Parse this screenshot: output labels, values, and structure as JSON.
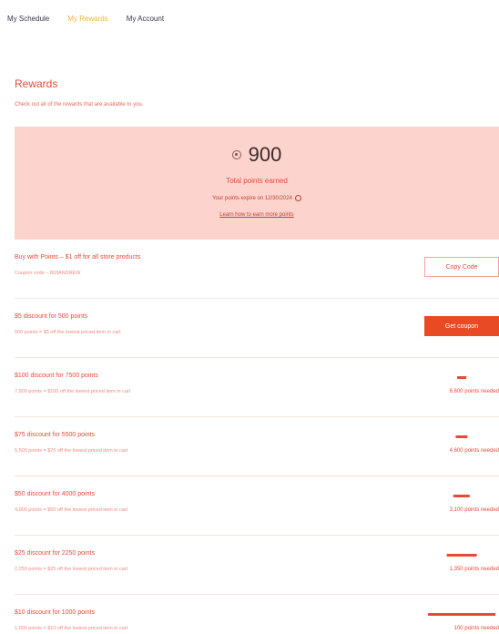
{
  "nav": {
    "tabs": [
      {
        "label": "My Schedule",
        "active": false
      },
      {
        "label": "My Rewards",
        "active": true
      },
      {
        "label": "My Account",
        "active": false
      }
    ]
  },
  "page": {
    "title": "Rewards",
    "subtitle": "Check out all of the rewards that are available to you."
  },
  "summary": {
    "points_icon": "coin-icon",
    "points": "900",
    "caption": "Total points earned",
    "expiry": "Your points expire on 12/30/2024",
    "learn_link": "Learn how to earn more points"
  },
  "rewards": [
    {
      "title": "Buy with Points – $1 off for all store products",
      "desc": "Coupon code – 803ANDREW",
      "action": "Copy Code"
    },
    {
      "title": "$5 discount for 500 points",
      "desc": "500 points = $5 off the lowest priced item in cart",
      "action": "Get coupon"
    },
    {
      "title": "$100 discount for 7500 points",
      "desc": "7,500 points = $100 off the lowest priced item in cart",
      "needed": "6,600 points needed",
      "progress": 0.12
    },
    {
      "title": "$75 discount for 5500 points",
      "desc": "5,500 points = $75 off the lowest priced item in cart",
      "needed": "4,600 points needed",
      "progress": 0.16
    },
    {
      "title": "$50 discount for 4000 points",
      "desc": "4,000 points = $50 off the lowest priced item in cart",
      "needed": "3,100 points needed",
      "progress": 0.225
    },
    {
      "title": "$25 discount for 2250 points",
      "desc": "2,250 points = $25 off the lowest priced item in cart",
      "needed": "1,350 points needed",
      "progress": 0.4
    },
    {
      "title": "$10 discount for 1000 points",
      "desc": "1,000 points = $10 off the lowest priced item in cart",
      "needed": "100 points needed",
      "progress": 0.9
    }
  ]
}
